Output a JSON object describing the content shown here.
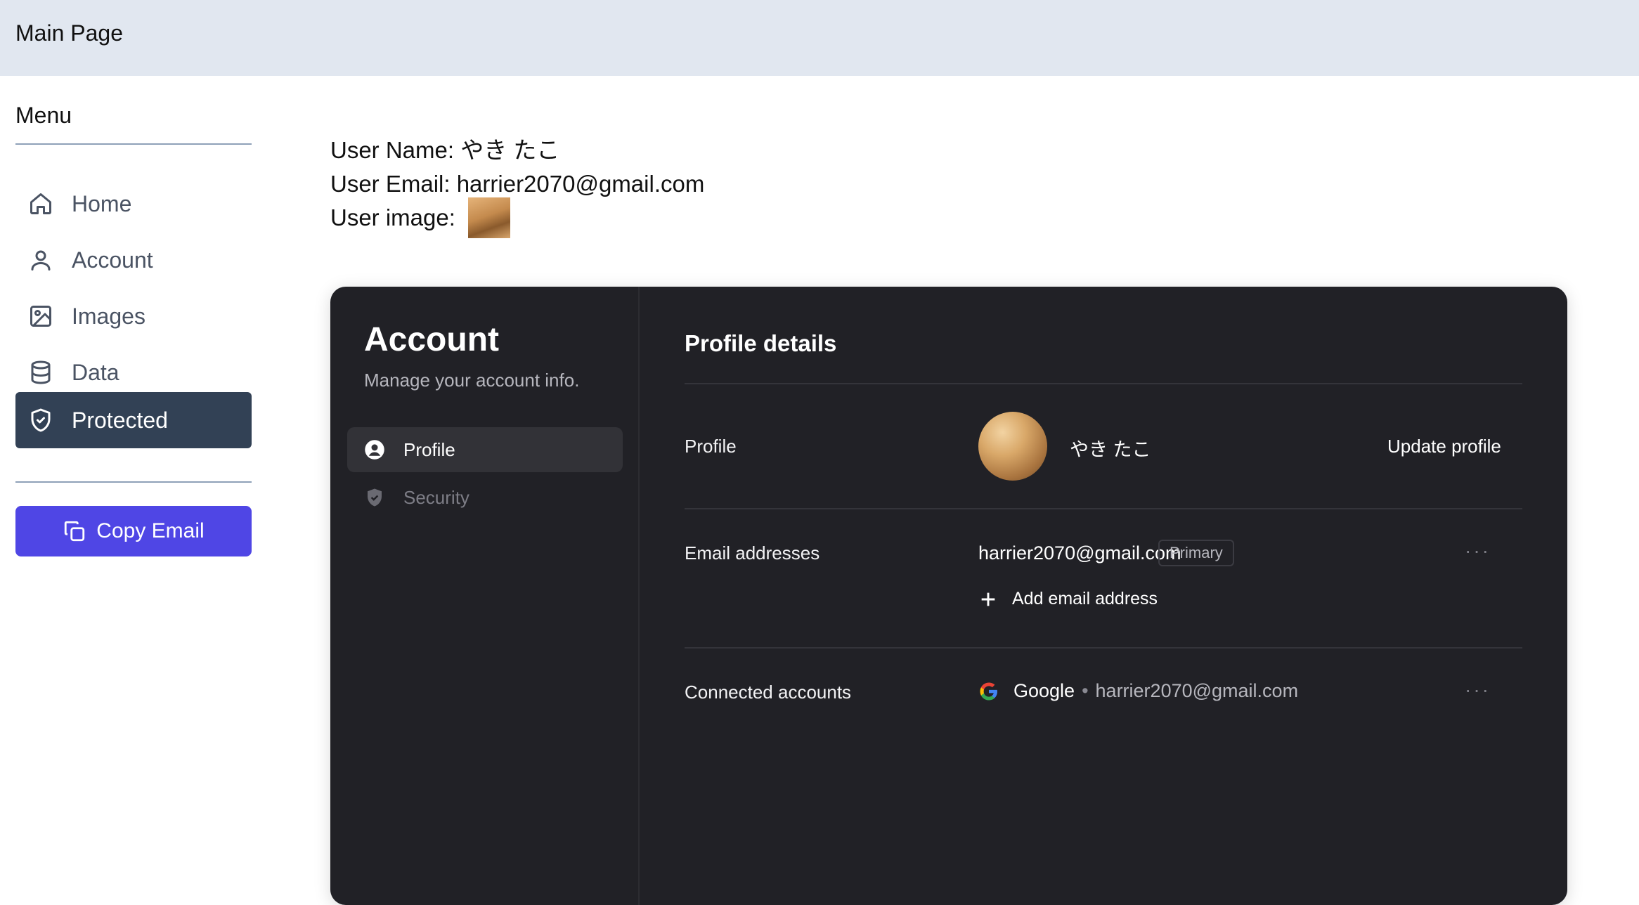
{
  "header": {
    "title": "Main Page"
  },
  "sidebar": {
    "menu_title": "Menu",
    "items": [
      {
        "label": "Home",
        "icon": "home-icon",
        "active": false
      },
      {
        "label": "Account",
        "icon": "user-icon",
        "active": false
      },
      {
        "label": "Images",
        "icon": "image-icon",
        "active": false
      },
      {
        "label": "Data",
        "icon": "database-icon",
        "active": true
      },
      {
        "label": "Protected",
        "icon": "shield-check-icon",
        "active": true
      }
    ],
    "copy_button": "Copy Email"
  },
  "user_info": {
    "name_line": "User Name: やき たこ",
    "email_line": "User Email: harrier2070@gmail.com",
    "image_label": "User image:"
  },
  "account_card": {
    "title": "Account",
    "subtitle": "Manage your account info.",
    "tabs": [
      {
        "label": "Profile",
        "active": true
      },
      {
        "label": "Security",
        "active": false
      }
    ],
    "section_title": "Profile details",
    "profile": {
      "label": "Profile",
      "name": "やき たこ",
      "update_label": "Update profile"
    },
    "emails": {
      "label": "Email addresses",
      "address": "harrier2070@gmail.com",
      "badge": "Primary",
      "add_label": "Add email address",
      "menu": "···"
    },
    "connected": {
      "label": "Connected accounts",
      "provider": "Google",
      "separator": "•",
      "email": "harrier2070@gmail.com",
      "menu": "···"
    }
  },
  "colors": {
    "header_bg": "#e1e7f0",
    "active_nav_bg": "#324155",
    "copy_button_bg": "#4f46e5",
    "card_bg": "#212126"
  }
}
